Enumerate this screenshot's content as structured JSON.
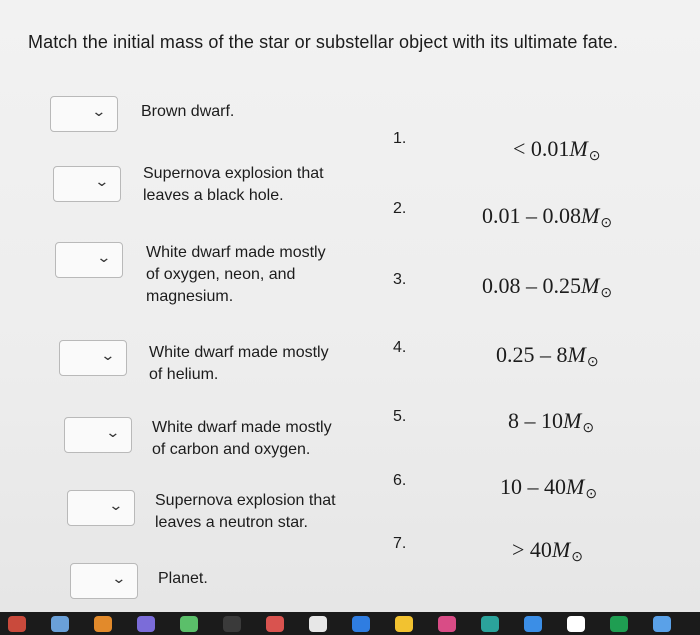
{
  "question": "Match the initial mass of the star or substellar object with its ultimate fate.",
  "dropdown_icon": "chevron-down-icon",
  "fates": [
    {
      "label": "Brown dwarf."
    },
    {
      "label": "Supernova explosion that\nleaves a black hole."
    },
    {
      "label": "White dwarf made mostly\nof oxygen, neon, and\nmagnesium."
    },
    {
      "label": "White dwarf made mostly\nof helium."
    },
    {
      "label": "White dwarf made mostly\nof carbon and oxygen."
    },
    {
      "label": "Supernova explosion that\nleaves a neutron star."
    },
    {
      "label": "Planet."
    }
  ],
  "masses": [
    {
      "num": "1.",
      "prefix": "< 0.01"
    },
    {
      "num": "2.",
      "prefix": "0.01 – 0.08"
    },
    {
      "num": "3.",
      "prefix": "0.08 – 0.25"
    },
    {
      "num": "4.",
      "prefix": "0.25 – 8"
    },
    {
      "num": "5.",
      "prefix": "8 – 10"
    },
    {
      "num": "6.",
      "prefix": "10 – 40"
    },
    {
      "num": "7.",
      "prefix": "> 40"
    }
  ],
  "mass_symbol": "M",
  "sun_symbol": "⊙",
  "dock_colors": [
    "#c94a3c",
    "#6aa0d8",
    "#e28a2b",
    "#7b6cd9",
    "#5bbf6a",
    "#3a3a3a",
    "#d9534f",
    "#e7e7e7",
    "#2f7de1",
    "#f2c230",
    "#d94c86",
    "#2ba39b",
    "#3b8ee6",
    "#ffffff",
    "#1f9e52",
    "#5aa1e8"
  ]
}
